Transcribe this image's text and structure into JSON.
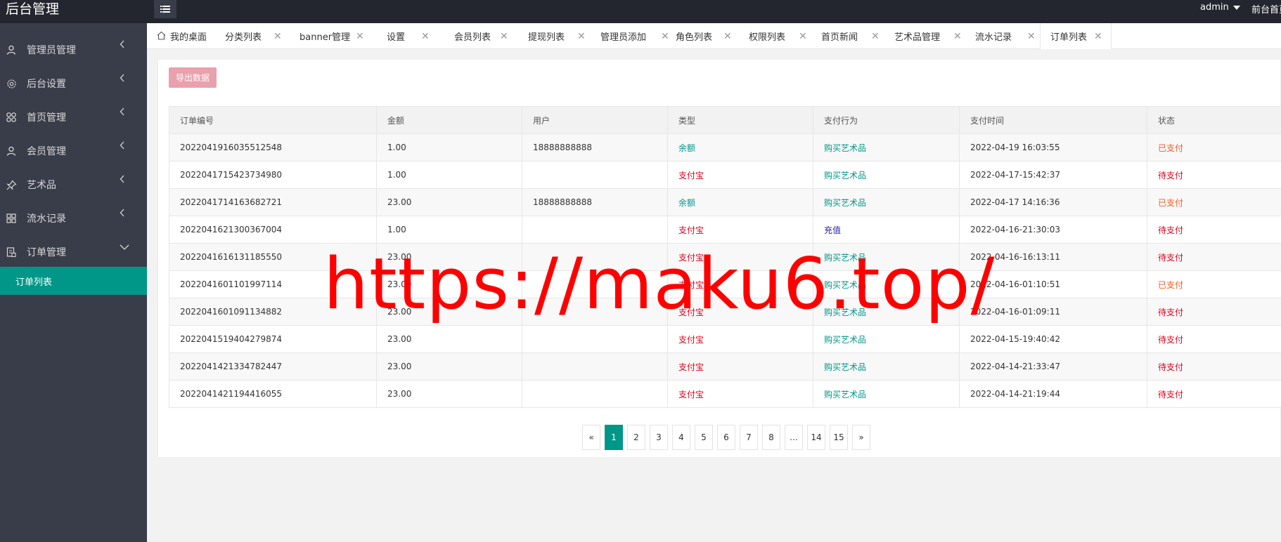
{
  "app": {
    "title": "后台管理",
    "user": "admin",
    "front_link": "前台首页"
  },
  "sidebar": {
    "items": [
      {
        "label": "管理员管理",
        "icon": "user-icon"
      },
      {
        "label": "后台设置",
        "icon": "gear-icon"
      },
      {
        "label": "首页管理",
        "icon": "grid-icon"
      },
      {
        "label": "会员管理",
        "icon": "user-icon"
      },
      {
        "label": "艺术品",
        "icon": "pin-icon"
      },
      {
        "label": "流水记录",
        "icon": "grid-icon"
      },
      {
        "label": "订单管理",
        "icon": "file-icon"
      }
    ],
    "sub_item": "订单列表"
  },
  "tabs": [
    {
      "label": "我的桌面"
    },
    {
      "label": "分类列表"
    },
    {
      "label": "banner管理"
    },
    {
      "label": "设置"
    },
    {
      "label": "会员列表"
    },
    {
      "label": "提现列表"
    },
    {
      "label": "管理员添加"
    },
    {
      "label": "角色列表"
    },
    {
      "label": "权限列表"
    },
    {
      "label": "首页新闻"
    },
    {
      "label": "艺术品管理"
    },
    {
      "label": "流水记录"
    },
    {
      "label": "订单列表"
    }
  ],
  "toolbar": {
    "export_label": "导出数据"
  },
  "table": {
    "headers": [
      "订单编号",
      "金额",
      "用户",
      "类型",
      "支付行为",
      "支付时间",
      "状态"
    ],
    "rows": [
      [
        "2022041916035512548",
        "1.00",
        "18888888888",
        "余额",
        "购买艺术品",
        "2022-04-19 16:03:55",
        "已支付"
      ],
      [
        "2022041715423734980",
        "1.00",
        "",
        "支付宝",
        "购买艺术品",
        "2022-04-17-15:42:37",
        "待支付"
      ],
      [
        "2022041714163682721",
        "23.00",
        "18888888888",
        "余额",
        "购买艺术品",
        "2022-04-17 14:16:36",
        "已支付"
      ],
      [
        "2022041621300367004",
        "1.00",
        "",
        "支付宝",
        "充值",
        "2022-04-16-21:30:03",
        "待支付"
      ],
      [
        "2022041616131185550",
        "23.00",
        "",
        "支付宝",
        "购买艺术品",
        "2022-04-16-16:13:11",
        "待支付"
      ],
      [
        "2022041601101997114",
        "23.00",
        "",
        "支付宝",
        "购买艺术品",
        "2022-04-16-01:10:51",
        "已支付"
      ],
      [
        "2022041601091134882",
        "23.00",
        "",
        "支付宝",
        "购买艺术品",
        "2022-04-16-01:09:11",
        "待支付"
      ],
      [
        "2022041519404279874",
        "23.00",
        "",
        "支付宝",
        "购买艺术品",
        "2022-04-15-19:40:42",
        "待支付"
      ],
      [
        "2022041421334782447",
        "23.00",
        "",
        "支付宝",
        "购买艺术品",
        "2022-04-14-21:33:47",
        "待支付"
      ],
      [
        "2022041421194416055",
        "23.00",
        "",
        "支付宝",
        "购买艺术品",
        "2022-04-14-21:19:44",
        "待支付"
      ]
    ]
  },
  "pagination": {
    "prev": "«",
    "pages": [
      "1",
      "2",
      "3",
      "4",
      "5",
      "6",
      "7",
      "8",
      "…",
      "14",
      "15"
    ],
    "current": "1",
    "next": "»"
  },
  "watermark": "https://maku6.top/",
  "colors": {
    "accent": "#009688",
    "sidebar": "#393d49",
    "header": "#23262e",
    "export": "#e8a1ad",
    "red": "#e0001a",
    "orange": "#ff5722"
  }
}
